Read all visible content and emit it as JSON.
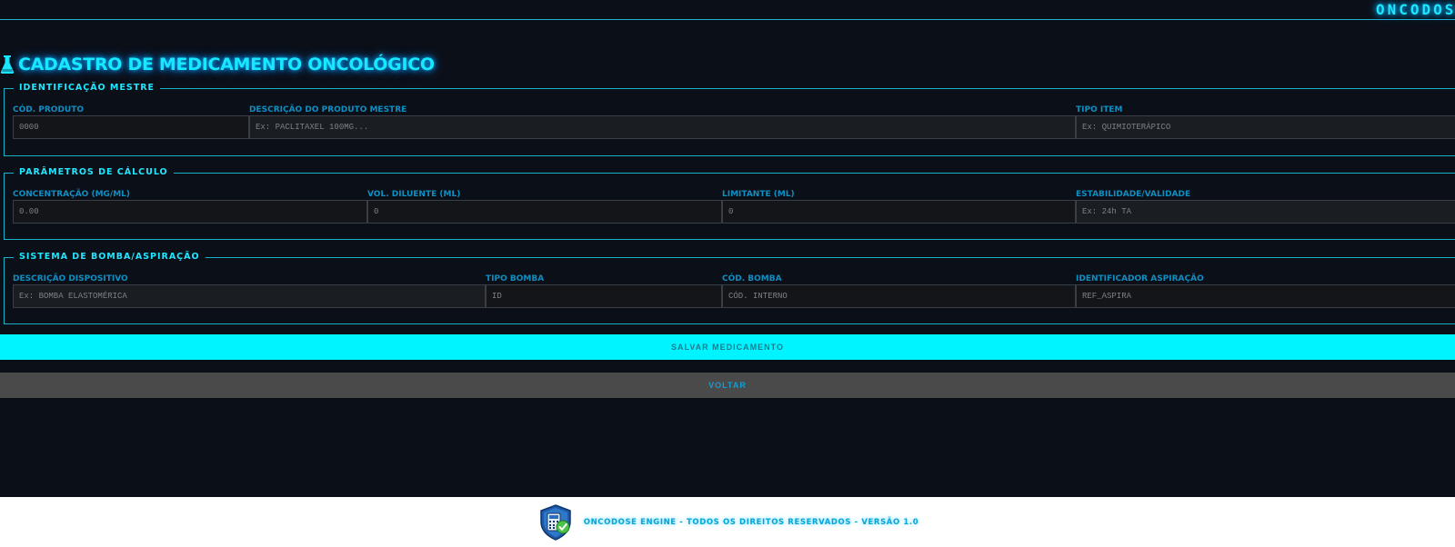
{
  "header": {
    "brand": "ONCODOSE",
    "page_title": "CADASTRO DE MEDICAMENTO ONCOLÓGICO",
    "title_icon": "flask-icon"
  },
  "groups": {
    "mestre": {
      "legend": "IDENTIFICAÇÃO MESTRE",
      "cod_produto": {
        "label": "CÓD. PRODUTO",
        "placeholder": "0000"
      },
      "descricao": {
        "label": "DESCRIÇÃO DO PRODUTO MESTRE",
        "placeholder": "Ex: PACLITAXEL 100MG..."
      },
      "tipo_item": {
        "label": "TIPO ITEM",
        "placeholder": "Ex: QUIMIOTERÁPICO"
      }
    },
    "calculo": {
      "legend": "PARÂMETROS DE CÁLCULO",
      "concentracao": {
        "label": "CONCENTRAÇÃO (MG/ML)",
        "placeholder": "0.00"
      },
      "vol_diluente": {
        "label": "VOL. DILUENTE (ML)",
        "placeholder": "0"
      },
      "limitante": {
        "label": "LIMITANTE (ML)",
        "placeholder": "0"
      },
      "estabilidade": {
        "label": "ESTABILIDADE/VALIDADE",
        "placeholder": "Ex: 24h TA"
      }
    },
    "bomba": {
      "legend": "SISTEMA DE BOMBA/ASPIRAÇÃO",
      "descricao_dispositivo": {
        "label": "DESCRIÇÃO DISPOSITIVO",
        "placeholder": "Ex: BOMBA ELASTOMÉRICA"
      },
      "tipo_bomba": {
        "label": "TIPO BOMBA",
        "placeholder": "ID"
      },
      "cod_bomba": {
        "label": "CÓD. BOMBA",
        "placeholder": "CÓD. INTERNO"
      },
      "identificador_aspiracao": {
        "label": "IDENTIFICADOR ASPIRAÇÃO",
        "placeholder": "REF_ASPIRA"
      }
    }
  },
  "actions": {
    "save_label": "SALVAR MEDICAMENTO",
    "back_label": "VOLTAR"
  },
  "footer": {
    "text": "ONCODOSE ENGINE - TODOS OS DIREITOS RESERVADOS - VERSÃO 1.0",
    "logo_icon": "calculator-shield-check-icon"
  },
  "colors": {
    "background": "#0b0f17",
    "accent": "#00f4ff",
    "label": "#0e8fc4",
    "button_secondary": "#4a4a4a"
  }
}
